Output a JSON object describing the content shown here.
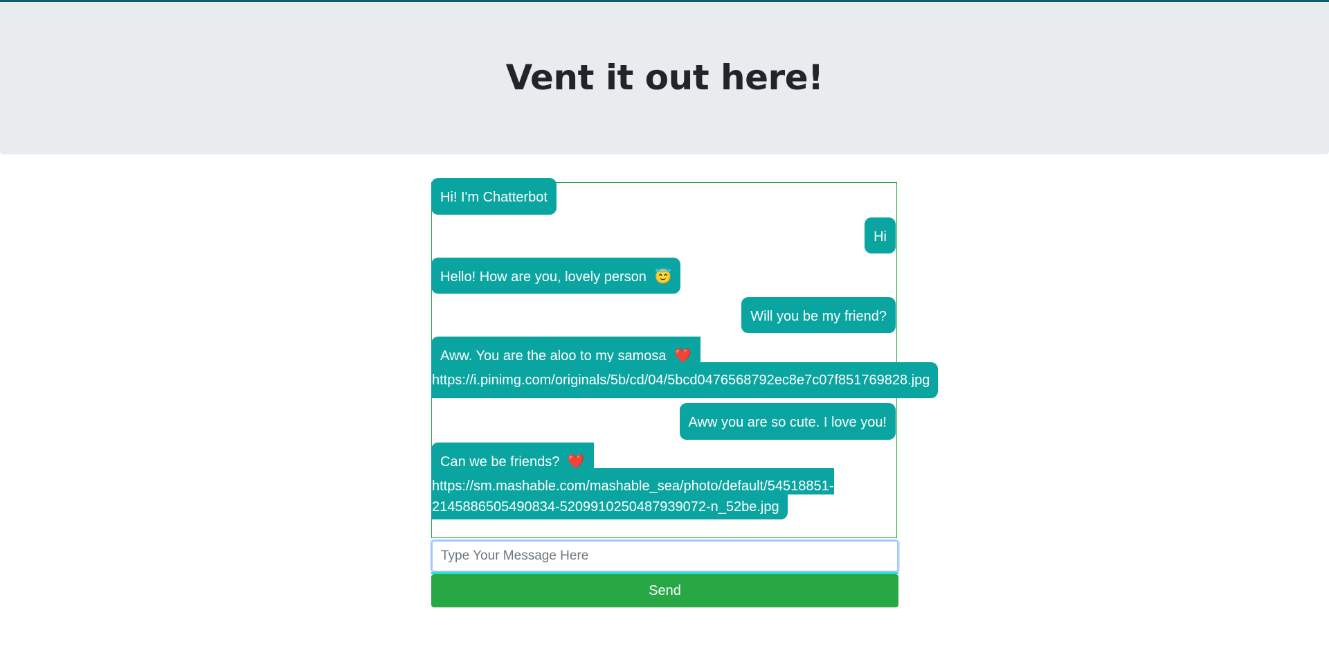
{
  "header": {
    "title": "Vent it out here!"
  },
  "chat": {
    "messages": [
      {
        "sender": "bot",
        "text": "Hi! I'm Chatterbot"
      },
      {
        "sender": "user",
        "text": "Hi"
      },
      {
        "sender": "bot",
        "text": "Hello! How are you, lovely person",
        "emoji": "😇"
      },
      {
        "sender": "user",
        "text": "Will you be my friend?"
      },
      {
        "sender": "bot",
        "text": "Aww. You are the aloo to my samosa",
        "emoji": "❤️",
        "link": "https://i.pinimg.com/originals/5b/cd/04/5bcd0476568792ec8e7c07f851769828.jpg"
      },
      {
        "sender": "user",
        "text": "Aww you are so cute. I love you!"
      },
      {
        "sender": "bot",
        "text": "Can we be friends?",
        "emoji": "❤️",
        "link_line1": "https://sm.mashable.com/mashable_sea/photo/default/54518851-",
        "link_line2": "2145886505490834-5209910250487939072-n_52be.jpg"
      }
    ]
  },
  "composer": {
    "placeholder": "Type Your Message Here",
    "send_label": "Send"
  },
  "colors": {
    "bubble": "#0aa5a0",
    "send_button": "#28a745",
    "jumbotron": "#e9ecef"
  }
}
